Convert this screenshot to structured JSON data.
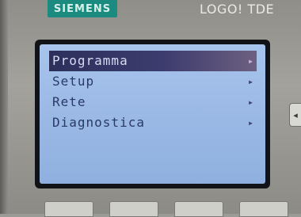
{
  "device": {
    "brand": "SIEMENS",
    "model": "LOGO! TDE"
  },
  "menu": {
    "items": [
      {
        "label": "Programma",
        "selected": true
      },
      {
        "label": "Setup",
        "selected": false
      },
      {
        "label": "Rete",
        "selected": false
      },
      {
        "label": "Diagnostica",
        "selected": false
      }
    ],
    "chevron_icon": "chevron-right-icon"
  },
  "colors": {
    "screen_bg": "#a7c4ed",
    "highlight": "#2d2f5b",
    "brand_badge": "#1c8b7f"
  }
}
